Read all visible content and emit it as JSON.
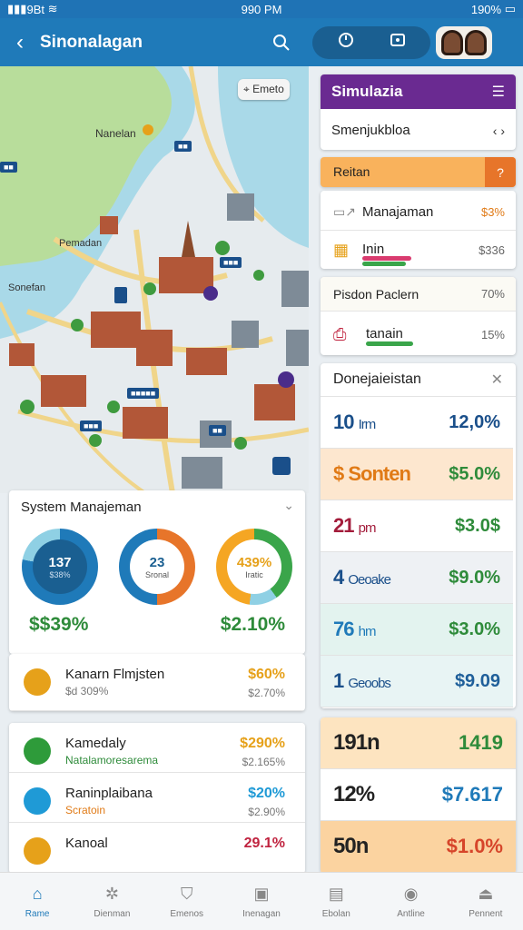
{
  "status": {
    "left": "9Bt",
    "time": "990 PM",
    "right": "190%"
  },
  "header": {
    "title": "Sinonalagan"
  },
  "map": {
    "button": "Emeto",
    "labels": [
      "Nanelan",
      "Pemadan",
      "Sonefan"
    ]
  },
  "sim": {
    "title": "Simulazia",
    "subtitle": "Smenjukbloa",
    "orange_label": "Reitan",
    "rows": [
      {
        "label": "Manajaman",
        "value": "$3%"
      },
      {
        "label": "Inin",
        "value": "$336"
      }
    ]
  },
  "packets": {
    "title": "Pisdon Paclern",
    "title_value": "70%",
    "row_label": "tanain",
    "row_value": "15%"
  },
  "donej": {
    "title": "Donejaieistan",
    "rows": [
      {
        "a": "10",
        "unit": "Irm",
        "b": "12,0%",
        "ac": "#1a4f8a",
        "bc": "#1a4f8a",
        "bg": "#ffffff"
      },
      {
        "a": "$ Sonten",
        "unit": "",
        "b": "$5.0%",
        "ac": "#e07a16",
        "bc": "#2e8b3a",
        "bg": "#fde7cf"
      },
      {
        "a": "21",
        "unit": "pm",
        "b": "$3.0$",
        "ac": "#a31c3b",
        "bc": "#2e8b3a",
        "bg": "#ffffff"
      },
      {
        "a": "4",
        "unit": "Oeoake",
        "b": "$9.0%",
        "ac": "#1a4f8a",
        "bc": "#2e8b3a",
        "bg": "#eef1f4"
      },
      {
        "a": "76",
        "unit": "hm",
        "b": "$3.0%",
        "ac": "#1f7ab9",
        "bc": "#2e8b3a",
        "bg": "#e3f3ef"
      },
      {
        "a": "1",
        "unit": "Geoobs",
        "b": "$9.09",
        "ac": "#1a4f8a",
        "bc": "#1f5f9a",
        "bg": "#e8f4f4"
      }
    ]
  },
  "bottomstats": [
    {
      "a": "191n",
      "b": "1419",
      "ac": "#222",
      "bc": "#2e8b3a",
      "bg": "#fde4c0"
    },
    {
      "a": "12%",
      "b": "$7.617",
      "ac": "#222",
      "bc": "#1f7ab9",
      "bg": "#ffffff"
    },
    {
      "a": "50n",
      "b": "$1.0%",
      "ac": "#222",
      "bc": "#d6452a",
      "bg": "#fbd3a0"
    }
  ],
  "system": {
    "title": "System Manajeman",
    "donuts": [
      {
        "main": "137",
        "sub": "$38%",
        "dark": true
      },
      {
        "main": "23",
        "sub": "Sronal",
        "dark": false
      },
      {
        "main": "439%",
        "sub": "Iratic",
        "dark": false
      }
    ],
    "left_value": "$$39%",
    "right_value": "$2.10%"
  },
  "list1": [
    {
      "t1": "Kanarn Flmjsten",
      "t2": "$d 309%",
      "v1": "$60%",
      "v2": "$2.70%",
      "c1": "#e6a11a"
    }
  ],
  "list2": [
    {
      "t1": "Kamedaly",
      "t2": "Natalamoresarema",
      "v1": "$290%",
      "v2": "$2.165%",
      "c1": "#e6a11a",
      "t2c": "#2e8b3a"
    },
    {
      "t1": "Raninplaibana",
      "t2": "Scratoin",
      "v1": "$20%",
      "v2": "$2.90%",
      "c1": "#1f9ad6",
      "t2c": "#e07a16"
    },
    {
      "t1": "Kanoal",
      "t2": "",
      "v1": "29.1%",
      "v2": "",
      "c1": "#c0233f",
      "t2c": "#333"
    }
  ],
  "nav": [
    "Rame",
    "Dienman",
    "Emenos",
    "Inenagan",
    "Ebolan",
    "Antline",
    "Pennent"
  ],
  "colors": {
    "primary": "#1f7ab9",
    "purple": "#6a2a91",
    "orange": "#f7a04b"
  }
}
